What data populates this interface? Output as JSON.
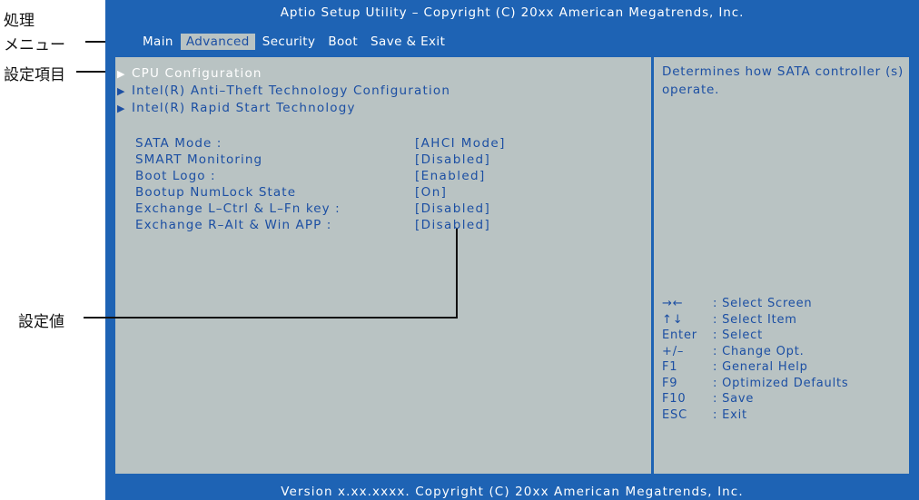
{
  "bios": {
    "title": "Aptio Setup Utility – Copyright (C) 20xx American Megatrends, Inc.",
    "menu": [
      "Main",
      "Advanced",
      "Security",
      "Boot",
      "Save & Exit"
    ],
    "active_menu": "Advanced",
    "submenus": [
      {
        "label": "CPU Configuration",
        "selected": true
      },
      {
        "label": "Intel(R) Anti–Theft Technology Configuration",
        "selected": false
      },
      {
        "label": "Intel(R) Rapid Start Technology",
        "selected": false
      }
    ],
    "settings": [
      {
        "label": "SATA Mode :",
        "value": "[AHCI Mode]"
      },
      {
        "label": "SMART Monitoring",
        "value": "[Disabled]"
      },
      {
        "label": "Boot Logo :",
        "value": "[Enabled]"
      },
      {
        "label": "Bootup NumLock State",
        "value": "[On]"
      },
      {
        "label": "Exchange L–Ctrl & L–Fn key :",
        "value": "[Disabled]"
      },
      {
        "label": "Exchange R–Alt & Win APP :",
        "value": "[Disabled]"
      }
    ],
    "help_text": "Determines how SATA controller (s) operate.",
    "key_help": [
      {
        "key": "→←",
        "desc": ": Select Screen"
      },
      {
        "key": "↑↓",
        "desc": ": Select Item"
      },
      {
        "key": "Enter",
        "desc": ": Select"
      },
      {
        "key": "+/–",
        "desc": ": Change Opt."
      },
      {
        "key": "F1",
        "desc": ": General Help"
      },
      {
        "key": "F9",
        "desc": ": Optimized Defaults"
      },
      {
        "key": "F10",
        "desc": ": Save"
      },
      {
        "key": "ESC",
        "desc": ": Exit"
      }
    ],
    "footer": "Version x.xx.xxxx. Copyright (C) 20xx American Megatrends, Inc."
  },
  "callouts": {
    "menu_line1": "処理",
    "menu_line2": "メニュー",
    "items": "設定項目",
    "values": "設定値"
  },
  "colors": {
    "bios_blue": "#1e63b4",
    "panel_gray": "#b9c3c3",
    "text_blue": "#1c4fa3",
    "text_white": "#ffffff"
  }
}
